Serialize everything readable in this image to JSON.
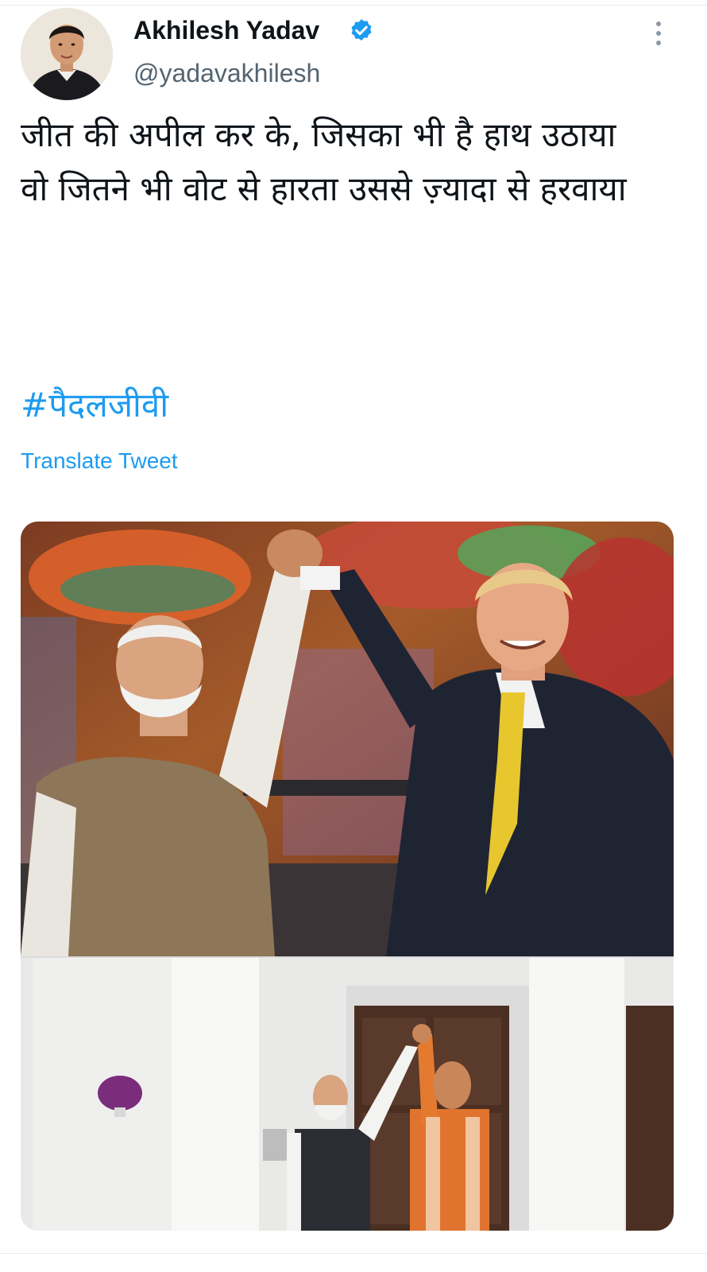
{
  "tweet": {
    "user": {
      "display_name": "Akhilesh Yadav",
      "handle": "@yadavakhilesh",
      "verified": true,
      "verified_icon": "verified-badge-icon",
      "verified_color": "#1d9bf0"
    },
    "more_icon": "more-vertical-icon",
    "text_lines": [
      "जीत की अपील कर के, जिसका भी है हाथ उठाया",
      "वो जितने भी वोट से हारता उससे ज़्यादा से हरवाया"
    ],
    "hashtag": "#पैदलजीवी",
    "translate_label": "Translate Tweet",
    "media": {
      "photo_count": 2
    }
  },
  "colors": {
    "text": "#0f1419",
    "secondary": "#536471",
    "link": "#1d9bf0"
  }
}
